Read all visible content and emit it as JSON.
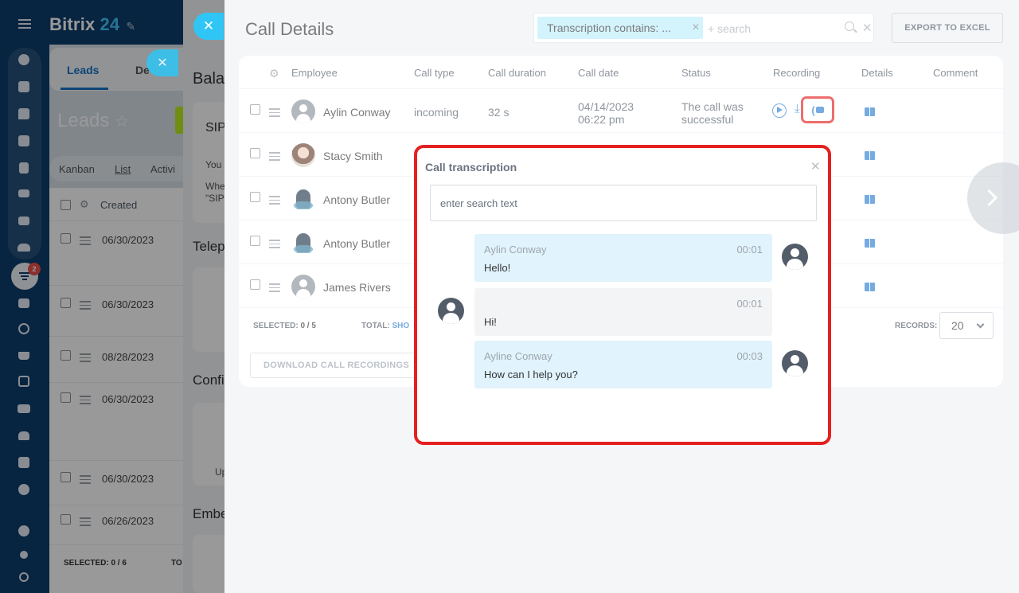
{
  "app": {
    "name": "Bitrix",
    "name_num": "24"
  },
  "rail": {
    "badge_count": "2"
  },
  "crm": {
    "tabs": {
      "leads": "Leads",
      "deals_partial": "De"
    },
    "title": "Leads",
    "views": {
      "kanban": "Kanban",
      "list": "List",
      "activities": "Activi"
    },
    "grid_header": {
      "created": "Created"
    },
    "rows": [
      "06/30/2023",
      "06/30/2023",
      "08/28/2023",
      "06/30/2023",
      "06/30/2023",
      "06/26/2023"
    ],
    "footer": {
      "selected": "SELECTED: 0 / 6",
      "total_partial": "TO"
    }
  },
  "middle_slider": {
    "heading1": "Bala",
    "card1_title": "SIP",
    "card1_line1": "You",
    "card1_line2": "Whe",
    "card1_line3": "\"SIP",
    "heading2": "Telep",
    "heading3": "Confi",
    "card3_text": "Up",
    "heading4": "Embe"
  },
  "call_details": {
    "title": "Call Details",
    "filter": {
      "chip": "Transcription contains: ...",
      "search_placeholder": "+ search"
    },
    "export_label": "EXPORT TO EXCEL",
    "columns": [
      "Employee",
      "Call type",
      "Call duration",
      "Call date",
      "Status",
      "Recording",
      "Details",
      "Comment"
    ],
    "rows": [
      {
        "employee": "Aylin Conway",
        "type": "incoming",
        "duration": "32 s",
        "date": "04/14/2023",
        "time": "06:22 pm",
        "status_l1": "The call was",
        "status_l2": "successful"
      },
      {
        "employee": "Stacy Smith"
      },
      {
        "employee": "Antony Butler"
      },
      {
        "employee": "Antony Butler"
      },
      {
        "employee": "James Rivers"
      }
    ],
    "footer": {
      "selected_label": "SELECTED:",
      "selected_value": "0 / 5",
      "total_label": "TOTAL:",
      "show_partial": "SHO",
      "records_label": "RECORDS:",
      "records_value": "20"
    },
    "download_label": "DOWNLOAD CALL RECORDINGS"
  },
  "transcription": {
    "title": "Call transcription",
    "search_placeholder": "enter search text",
    "messages": [
      {
        "who": "Aylin Conway",
        "time": "00:01",
        "text": "Hello!"
      },
      {
        "who": "",
        "time": "00:01",
        "text": "Hi!"
      },
      {
        "who": "Ayline Conway",
        "time": "00:03",
        "text": "How can I help you?"
      }
    ]
  },
  "colors": {
    "accent": "#2fc6f6",
    "link": "#2c7fd1",
    "highlight": "#e42020",
    "rail": "#0d3d6b"
  }
}
